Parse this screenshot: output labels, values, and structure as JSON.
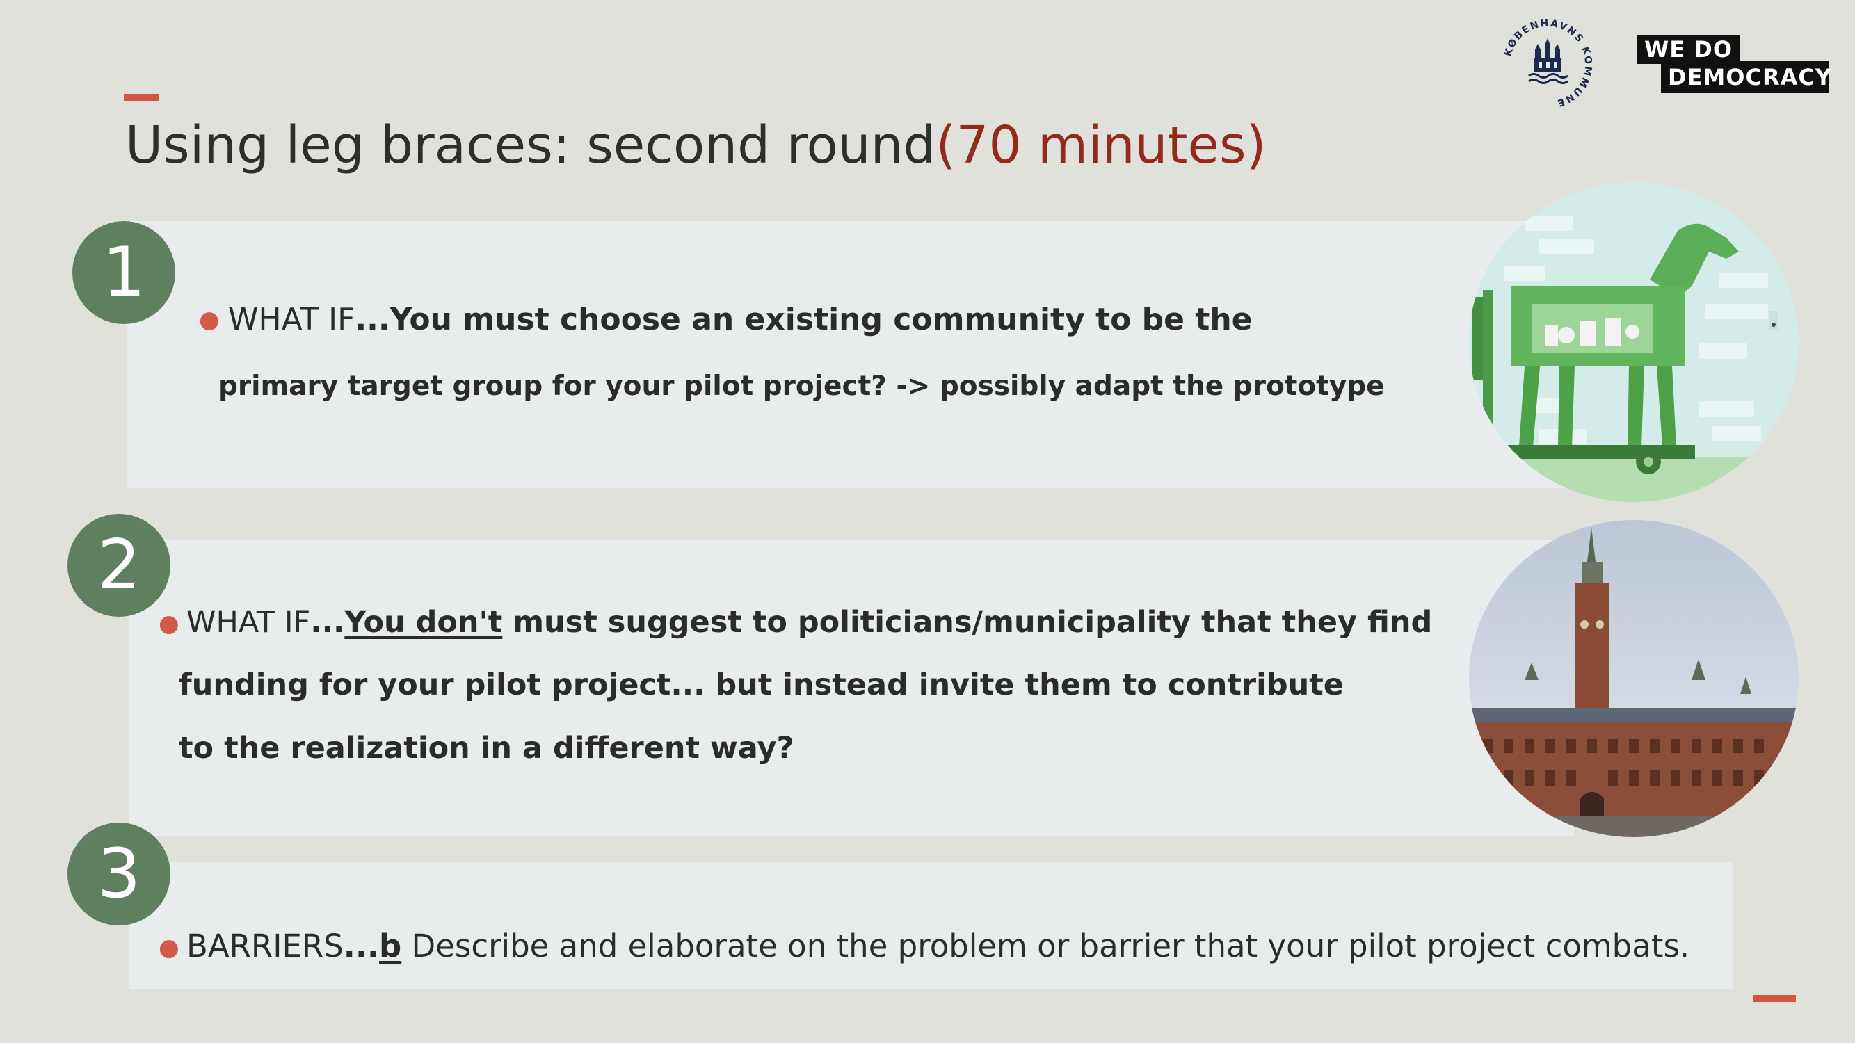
{
  "slide": {
    "title": "Using leg braces: second round",
    "duration": "(70 minutes)"
  },
  "items": [
    {
      "number": "1",
      "lead": "WHAT IF",
      "ellipsis": "...",
      "line1_rest": "You must choose an existing community to be the",
      "line2": "primary target group for your pilot project? -> possibly adapt the prototype"
    },
    {
      "number": "2",
      "lead": "WHAT IF",
      "ellipsis": "...",
      "underlined": "You don't",
      "line1_rest": " must suggest to politicians/municipality that they find",
      "line2": "funding for your pilot project... but instead invite them to contribute",
      "line3": "to the realization in a different way?"
    },
    {
      "number": "3",
      "lead": "BARRIERS",
      "ellipsis": "...",
      "underlined": "b",
      "rest": " Describe and elaborate on the problem or barrier that your pilot project combats."
    }
  ],
  "logos": {
    "kommune_text": "KØBENHAVNS KOMMUNE",
    "wedo_line1": "WE  DO",
    "wedo_line2": "DEMOCRACY"
  },
  "colors": {
    "background": "#e1e1dc",
    "panel": "#e9ecec",
    "number_circle": "#5e805f",
    "accent": "#cf5643",
    "duration": "#922b1c"
  },
  "icons": {
    "horse": "trojan-horse-illustration",
    "cityhall": "copenhagen-city-hall-photo"
  }
}
